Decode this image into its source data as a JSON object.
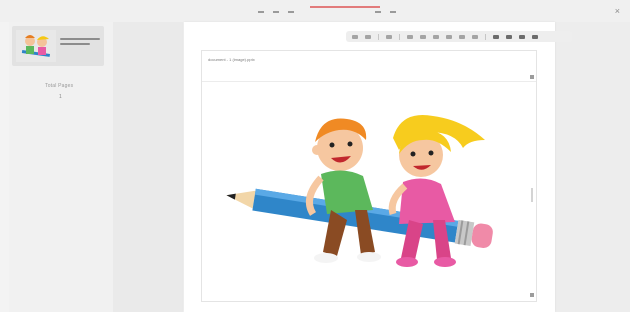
{
  "window": {
    "close_label": "×"
  },
  "sidebar": {
    "pages_label": "Total Pages",
    "pages_count": "1"
  },
  "document": {
    "title": "document - 1 (image).pptx",
    "image_name": "kids-on-pencil-icon"
  }
}
